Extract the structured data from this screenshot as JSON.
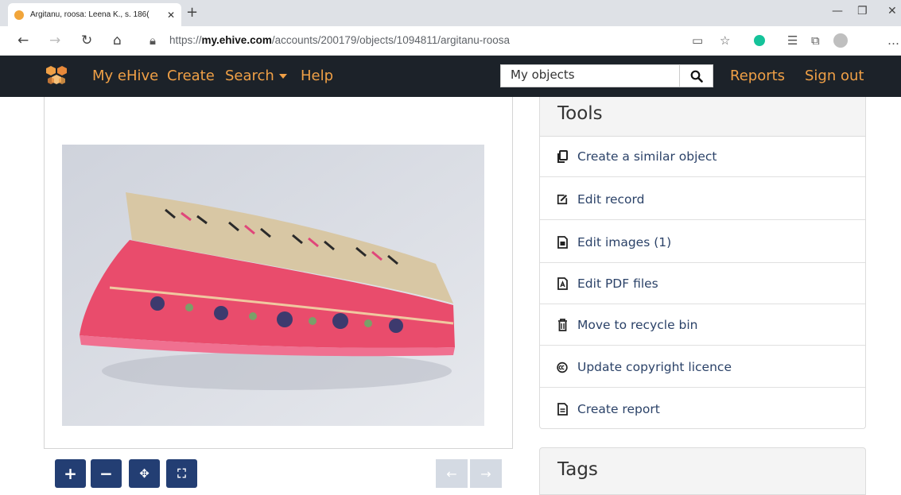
{
  "browser": {
    "tab_title": "Argitanu, roosa: Leena K., s. 186(",
    "tab_close": "✕",
    "new_tab": "+",
    "url_prefix": "https://",
    "url_domain": "my.ehive.com",
    "url_path": "/accounts/200179/objects/1094811/argitanu-roosa"
  },
  "nav": {
    "my_ehive": "My eHive",
    "create": "Create",
    "search": "Search",
    "help": "Help",
    "search_value": "My objects",
    "reports": "Reports",
    "sign_out": "Sign out"
  },
  "image_controls": {
    "zoom_in": "+",
    "zoom_out": "−",
    "home": "✥",
    "fullscreen": "⛶",
    "prev": "←",
    "next": "→"
  },
  "tools": {
    "title": "Tools",
    "items": [
      {
        "label": "Create a similar object",
        "icon": "copy-icon"
      },
      {
        "label": "Edit record",
        "icon": "edit-icon"
      },
      {
        "label": "Edit images (1)",
        "icon": "image-file-icon"
      },
      {
        "label": "Edit PDF files",
        "icon": "pdf-file-icon"
      },
      {
        "label": "Move to recycle bin",
        "icon": "trash-icon"
      },
      {
        "label": "Update copyright licence",
        "icon": "copyright-icon"
      },
      {
        "label": "Create report",
        "icon": "report-file-icon"
      }
    ]
  },
  "tags": {
    "title": "Tags"
  },
  "colors": {
    "navbar_bg": "#1c2229",
    "nav_link": "#f0a046",
    "tool_link": "#2b4268",
    "control_btn": "#233e73"
  }
}
